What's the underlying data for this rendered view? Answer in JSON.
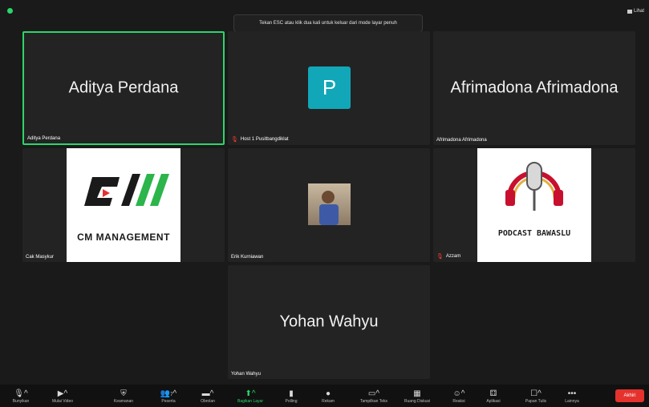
{
  "banner": {
    "text": "Tekan ESC atau klik dua kali untuk keluar dari mode layar penuh"
  },
  "view": {
    "label": "Lihat"
  },
  "tiles": {
    "aditya": {
      "big": "Aditya Perdana",
      "label": "Aditya Perdana"
    },
    "host": {
      "initial": "P",
      "label": "Host 1 Pusitbangdiklat"
    },
    "afrimadona": {
      "big": "Afrimadona Afrimadona",
      "label": "Afrimadona Afrimadona"
    },
    "cak": {
      "label": "Cak Masykur",
      "logo_text": "CM MANAGEMENT"
    },
    "erik": {
      "label": "Erik Kurniawan"
    },
    "azzam": {
      "label": "Azzam",
      "logo_text": "PODCAST BAWASLU"
    },
    "yohan": {
      "big": "Yohan Wahyu",
      "label": "Yohan Wahyu"
    }
  },
  "toolbar": {
    "items": [
      {
        "label": "Bunyikan",
        "icon": "microphone-muted-icon"
      },
      {
        "label": "Mulai Video",
        "icon": "video-off-icon"
      },
      {
        "label": "Keamanan",
        "icon": "shield-icon"
      },
      {
        "label": "Peserta",
        "icon": "participants-icon",
        "count": "7"
      },
      {
        "label": "Obrolan",
        "icon": "chat-icon"
      },
      {
        "label": "Bagikan Layar",
        "icon": "share-screen-icon"
      },
      {
        "label": "Polling",
        "icon": "poll-icon"
      },
      {
        "label": "Rekam",
        "icon": "record-icon"
      },
      {
        "label": "Tampilkan Teks",
        "icon": "captions-icon"
      },
      {
        "label": "Ruang Diskusi",
        "icon": "breakout-rooms-icon"
      },
      {
        "label": "Reaksi",
        "icon": "reaction-icon"
      },
      {
        "label": "Aplikasi",
        "icon": "apps-icon"
      },
      {
        "label": "Papan Tulis",
        "icon": "whiteboard-icon"
      },
      {
        "label": "Lainnya",
        "icon": "more-icon"
      }
    ],
    "end_label": "Akhiri"
  },
  "colors": {
    "active_border": "#2bd66a",
    "avatar": "#11a7b8",
    "end": "#e5322d",
    "muted": "#ff3b30"
  }
}
